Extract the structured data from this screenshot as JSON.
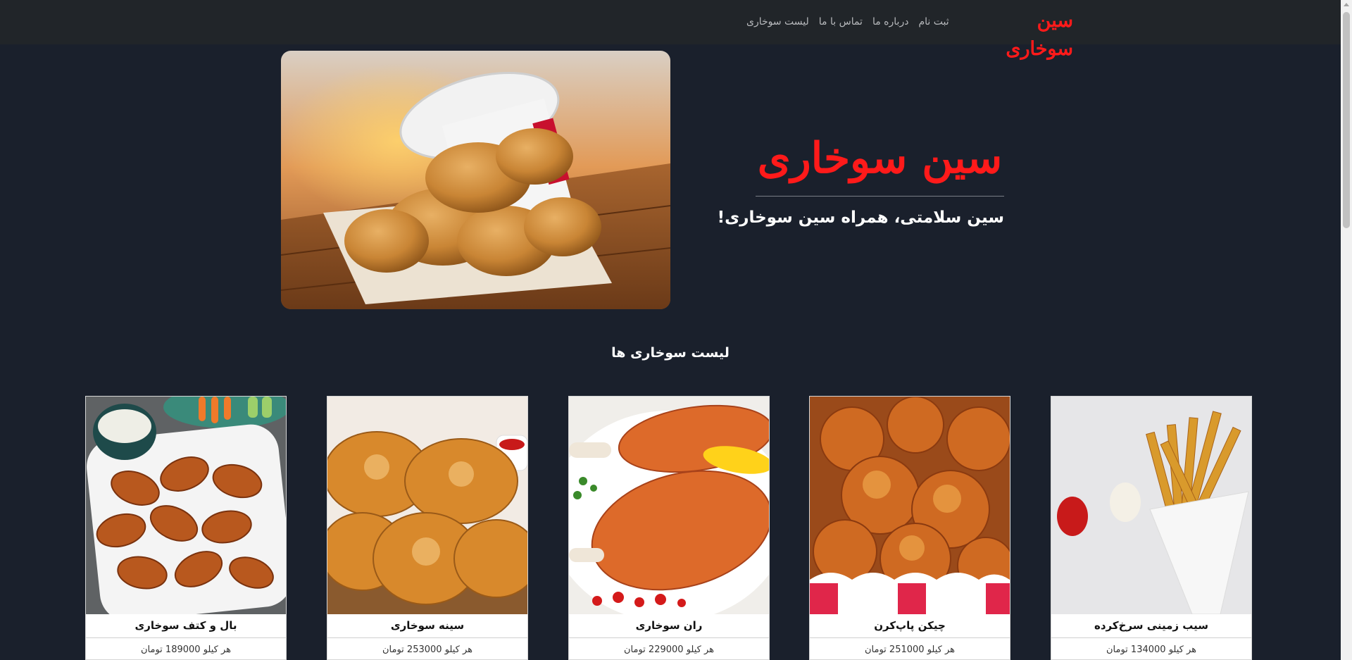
{
  "navbar": {
    "brand": "سین سوخاری",
    "links": [
      "لیست سوخاری",
      "تماس با ما",
      "درباره ما",
      "ثبت نام"
    ]
  },
  "hero": {
    "title": "سین سوخاری",
    "subtitle": "سین سلامتی، همراه سین سوخاری!"
  },
  "products": {
    "section_title": "لیست سوخاری ها",
    "items": [
      {
        "name": "سیب زمینی سرخ‌کرده",
        "price": "هر کیلو 134000 تومان"
      },
      {
        "name": "چیکن پاپ‌کرن",
        "price": "هر کیلو 251000 تومان"
      },
      {
        "name": "ران سوخاری",
        "price": "هر کیلو 229000 تومان"
      },
      {
        "name": "سینه سوخاری",
        "price": "هر کیلو 253000 تومان"
      },
      {
        "name": "بال و کتف سوخاری",
        "price": "هر کیلو 189000 تومان"
      }
    ]
  },
  "colors": {
    "background": "#1a202c",
    "navbar": "#212529",
    "accent": "#ff1a1a",
    "card": "#ffffff"
  }
}
